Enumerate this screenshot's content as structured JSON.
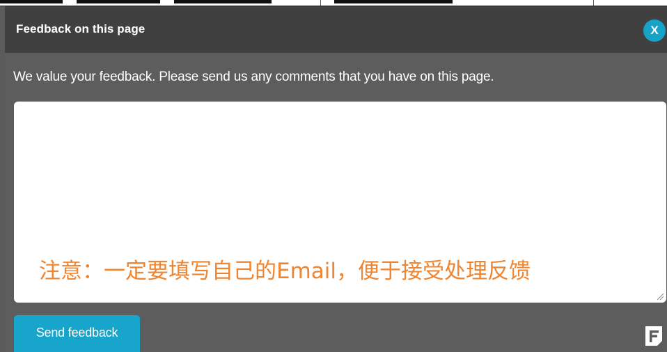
{
  "dialog": {
    "title": "Feedback on this page",
    "close_label": "X",
    "intro": "We value your feedback. Please send us any comments that you have on this page.",
    "comment_value": "",
    "comment_note": "注意：一定要填写自己的Email，便于接受处理反馈",
    "send_label": "Send feedback"
  },
  "icons": {
    "close": "close-icon",
    "resize": "resize-grip-icon",
    "brand": "feedback-brand-icon"
  },
  "colors": {
    "header_bg": "#404040",
    "panel_bg": "#5d5d5d",
    "accent": "#17a5cb",
    "note_text": "#f08531",
    "text": "#ffffff"
  }
}
